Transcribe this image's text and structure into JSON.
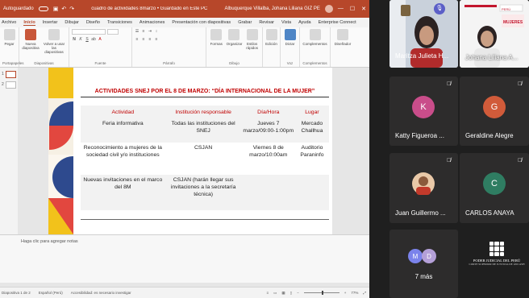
{
  "window": {
    "autosave_label": "Autoguardado",
    "doc_title": "cuadro de actividades 8marzo • Guardado en Este PC",
    "user_name": "Albuquerque Villalba, Johana Liliana GIZ PE"
  },
  "tabs": [
    "Archivo",
    "Inicio",
    "Insertar",
    "Dibujar",
    "Diseño",
    "Transiciones",
    "Animaciones",
    "Presentación con diapositivas",
    "Grabar",
    "Revisar",
    "Vista",
    "Ayuda",
    "Enterprise Connect"
  ],
  "ribbon": {
    "paste": "Pegar",
    "new_slide": "Nueva diapositiva",
    "reuse": "Volver a usar las diapositivas",
    "shapes": "Formas",
    "arrange": "Organizar",
    "quick_styles": "Estilos rápidos",
    "edit": "Edición",
    "dictate": "Dictar",
    "addins": "Complementos",
    "designer": "Diseñador",
    "groups": {
      "clipboard": "Portapapeles",
      "slides": "Diapositivas",
      "font": "Fuente",
      "paragraph": "Párrafo",
      "drawing": "Dibujo",
      "voice": "Voz",
      "addins": "Complementos"
    }
  },
  "thumbs": [
    "1",
    "2"
  ],
  "slide": {
    "title": "ACTIVIDADES SNEJ POR EL 8 DE MARZO: “DÍA INTERNACIONAL DE LA MUJER”",
    "headers": [
      "Actividad",
      "Institución responsable",
      "Día/Hora",
      "Lugar"
    ],
    "rows": [
      [
        "Feria informativa",
        "Todas las instituciones del SNEJ",
        "Jueves 7 marzo/09:00-1:00pm",
        "Mercado Challhua"
      ],
      [
        "Reconocimiento a mujeres de la sociedad civil y/o instituciones",
        "CSJAN",
        "Viernes 8 de marzo/10:00am",
        "Auditorio Paraninfo"
      ],
      [
        "Nuevas invitaciones en el marco del 8M",
        "CSJAN (harán llegar sus invitaciones a la secretaría técnica)",
        "",
        ""
      ]
    ]
  },
  "notes_placeholder": "Haga clic para agregar notas",
  "status": {
    "slide": "Diapositiva 1 de 2",
    "language": "Español (Perú)",
    "accessibility": "Accesibilidad: es necesario investigar",
    "zoom": "77%"
  },
  "participants": [
    {
      "name": "Maritza Julieta H...",
      "kind": "video"
    },
    {
      "name": "Johana Liliana A...",
      "kind": "video"
    },
    {
      "name": "Katty Figueroa ...",
      "initial": "K",
      "color": "#c94d8a",
      "kind": "avatar"
    },
    {
      "name": "Geraldine Alegre",
      "initial": "G",
      "color": "#d15b3a",
      "kind": "avatar"
    },
    {
      "name": "Juan Guillermo ...",
      "kind": "photo"
    },
    {
      "name": "CARLOS ANAYA",
      "initial": "C",
      "color": "#2f7d62",
      "kind": "avatar"
    }
  ],
  "more": {
    "label": "7 más",
    "initials": [
      "M",
      "D"
    ]
  },
  "org_logo": {
    "line1": "PODER JUDICIAL DEL PERÚ",
    "line2": "CORTE SUPERIOR DE JUSTICIA DE ÁNCASH"
  }
}
